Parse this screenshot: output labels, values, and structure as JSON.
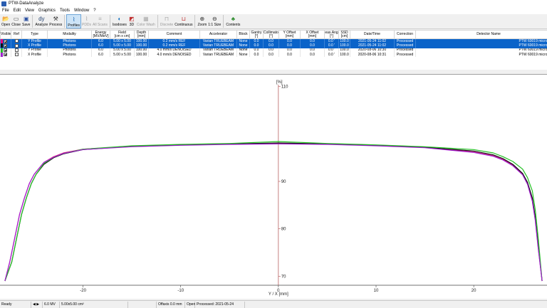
{
  "window": {
    "title": "PTW-DataAnalyze"
  },
  "menu": [
    "File",
    "Edit",
    "View",
    "Graphics",
    "Tools",
    "Window",
    "?"
  ],
  "toolbar": [
    {
      "label": "Open",
      "icon": "open-folder-icon",
      "enabled": true
    },
    {
      "label": "Close",
      "icon": "close-file-icon",
      "enabled": true
    },
    {
      "label": "Save",
      "icon": "save-disk-icon",
      "enabled": true
    },
    {
      "sep": true
    },
    {
      "label": "Analyze",
      "icon": "analyze-icon",
      "enabled": true
    },
    {
      "label": "Process",
      "icon": "process-tools-icon",
      "enabled": true
    },
    {
      "sep": true
    },
    {
      "label": "Profiles",
      "icon": "profiles-icon",
      "enabled": true,
      "active": true
    },
    {
      "label": "PDDs",
      "icon": "pdd-icon",
      "enabled": false
    },
    {
      "label": "All Scans",
      "icon": "all-scans-icon",
      "enabled": false
    },
    {
      "sep": true
    },
    {
      "label": "Isodoses",
      "icon": "isodoses-icon",
      "enabled": true
    },
    {
      "label": "3D",
      "icon": "3d-icon",
      "enabled": true
    },
    {
      "label": "Color Wash",
      "icon": "color-wash-icon",
      "enabled": false
    },
    {
      "sep": true
    },
    {
      "label": "Discrete",
      "icon": "discrete-icon",
      "enabled": false
    },
    {
      "label": "Continuous",
      "icon": "continuous-icon",
      "enabled": true
    },
    {
      "sep": true
    },
    {
      "label": "Zoom",
      "icon": "zoom-icon",
      "enabled": true
    },
    {
      "label": "1:1 Size",
      "icon": "zoom-1to1-icon",
      "enabled": true
    },
    {
      "sep": true
    },
    {
      "label": "Contents",
      "icon": "help-contents-icon",
      "enabled": true
    }
  ],
  "table": {
    "columns": [
      "Visible",
      "Ref",
      "Type",
      "Modality",
      "Energy\n[MV/MeV]",
      "Field\n[cm x cm]",
      "Depth\n[mm]",
      "Comment",
      "Accelerator",
      "Block",
      "Gantry\n[°]",
      "Collimator\n[°]",
      "Y Offset\n[mm]",
      "X Offset\n[mm]",
      "eas.Ang\n[°]",
      "SSD\n[cm]",
      "Date/Time",
      "Correction",
      "Detector Name"
    ],
    "rows": [
      {
        "color": "#e8007a",
        "selected": true,
        "visible": true,
        "ref": false,
        "cells": [
          "Y Profile",
          "Photons",
          "6.0",
          "5.00 x 5.00",
          "100.00",
          "0.2 mm/s REF",
          "Varian TRUEBEAM",
          "None",
          "0.0",
          "0.0",
          "0.0",
          "0.0",
          "0.0 '",
          "100.0",
          "2021-05-24 11:02",
          "Processed",
          "PTW 60019 microDiamond"
        ]
      },
      {
        "color": "#101010",
        "selected": true,
        "visible": true,
        "ref": false,
        "cells": [
          "X Profile",
          "Photons",
          "6.0",
          "5.00 x 5.00",
          "100.00",
          "0.2 mm/s REF",
          "Varian TRUEBEAM",
          "None",
          "0.0",
          "0.0",
          "0.0",
          "0.0",
          "0.0 '",
          "100.0",
          "2021-05-24 11:02",
          "Processed",
          "PTW 60019 microDiamond"
        ]
      },
      {
        "color": "#22c022",
        "selected": false,
        "visible": true,
        "ref": false,
        "cells": [
          "Y Profile",
          "Photons",
          "6.0",
          "5.00 x 5.00",
          "100.00",
          "4.0 mm/s DENOISED",
          "Varian TRUEBEAM",
          "None",
          "0.0",
          "0.0",
          "0.0",
          "0.0",
          "0.0 '",
          "100.0",
          "2020-08-06 10:30",
          "Processed",
          "PTW 60019 microDiamond"
        ]
      },
      {
        "color": "#a020d0",
        "selected": false,
        "visible": true,
        "ref": false,
        "cells": [
          "X Profile",
          "Photons",
          "6.0",
          "5.00 x 5.00",
          "100.00",
          "4.0 mm/s DENOISED",
          "Varian TRUEBEAM",
          "None",
          "0.0",
          "0.0",
          "0.0",
          "0.0",
          "0.0 '",
          "100.0",
          "2020-08-06 10:31",
          "Processed",
          "PTW 60019 microDiamond"
        ]
      }
    ]
  },
  "status": {
    "ready": "Ready",
    "energy": "6.0 MV",
    "field": "5.00x5.00 cm²",
    "offaxis": "Offaxis 0.0 mm",
    "state": "Open",
    "processed": "Processed: 2021-05-24"
  },
  "chart_data": {
    "type": "line",
    "xlabel": "Y / X [mm]",
    "ylabel": "[%]",
    "xlim": [
      -28.5,
      27.5
    ],
    "ylim": [
      69,
      111
    ],
    "xticks": [
      -20,
      -10,
      0,
      10,
      20
    ],
    "yticks": [
      70,
      80,
      90,
      110
    ],
    "grid": false,
    "series": [
      {
        "color": "#e8007a",
        "x": [
          -28,
          -27.5,
          -27,
          -26.5,
          -26,
          -25.5,
          -25,
          -24,
          -23,
          -22,
          -20,
          -15,
          -10,
          -5,
          0,
          5,
          10,
          15,
          20,
          22,
          23,
          24,
          25,
          25.5,
          26,
          26.3,
          26.6,
          27
        ],
        "y": [
          69,
          73,
          78,
          83,
          86.5,
          89.5,
          91.5,
          94,
          95.2,
          96,
          96.8,
          97.4,
          97.7,
          97.9,
          98,
          97.9,
          97.6,
          97.2,
          96.2,
          95.4,
          94.6,
          93.4,
          91.5,
          89.5,
          86,
          82,
          76,
          69
        ]
      },
      {
        "color": "#101010",
        "x": [
          -28,
          -27.3,
          -26.8,
          -26.3,
          -25.8,
          -25.3,
          -24.8,
          -24,
          -23,
          -22,
          -20,
          -15,
          -10,
          -5,
          0,
          5,
          10,
          15,
          20,
          22,
          23,
          24,
          25,
          25.5,
          26,
          26.3,
          26.6,
          27
        ],
        "y": [
          69,
          73,
          78,
          83,
          86.5,
          89.5,
          91.5,
          93.6,
          95,
          95.8,
          96.7,
          97.4,
          97.7,
          97.9,
          98.1,
          97.9,
          97.6,
          97.2,
          96.4,
          95.6,
          94.8,
          93.6,
          91.7,
          89.8,
          86.5,
          82.5,
          76.5,
          69
        ]
      },
      {
        "color": "#22c022",
        "x": [
          -28,
          -27.3,
          -26.8,
          -26.3,
          -25.8,
          -25.3,
          -24.8,
          -24,
          -23,
          -22,
          -20,
          -15,
          -10,
          -5,
          0,
          5,
          10,
          15,
          20,
          22,
          23,
          24,
          25,
          25.5,
          26,
          26.3,
          26.6,
          27
        ],
        "y": [
          69,
          73,
          78,
          83,
          86.5,
          89.5,
          91.5,
          93.8,
          95.1,
          95.9,
          96.8,
          97.5,
          97.8,
          98,
          98.4,
          98,
          97.7,
          97.3,
          96.7,
          96,
          95.2,
          94.2,
          92.6,
          90.8,
          88,
          84,
          78,
          69
        ]
      },
      {
        "color": "#a020d0",
        "x": [
          -28,
          -27.5,
          -27,
          -26.5,
          -26,
          -25.5,
          -25,
          -24,
          -23,
          -22,
          -20,
          -15,
          -10,
          -5,
          0,
          5,
          10,
          15,
          20,
          22,
          23,
          24,
          25,
          25.5,
          26,
          26.3,
          26.6,
          27
        ],
        "y": [
          69,
          73,
          78,
          83,
          86.5,
          89.5,
          91.5,
          94,
          95.1,
          95.9,
          96.7,
          97.3,
          97.6,
          97.8,
          97.9,
          97.8,
          97.5,
          97.1,
          96.1,
          95.3,
          94.5,
          93.3,
          91.4,
          89.4,
          85.8,
          81.8,
          75.8,
          69
        ]
      }
    ]
  }
}
